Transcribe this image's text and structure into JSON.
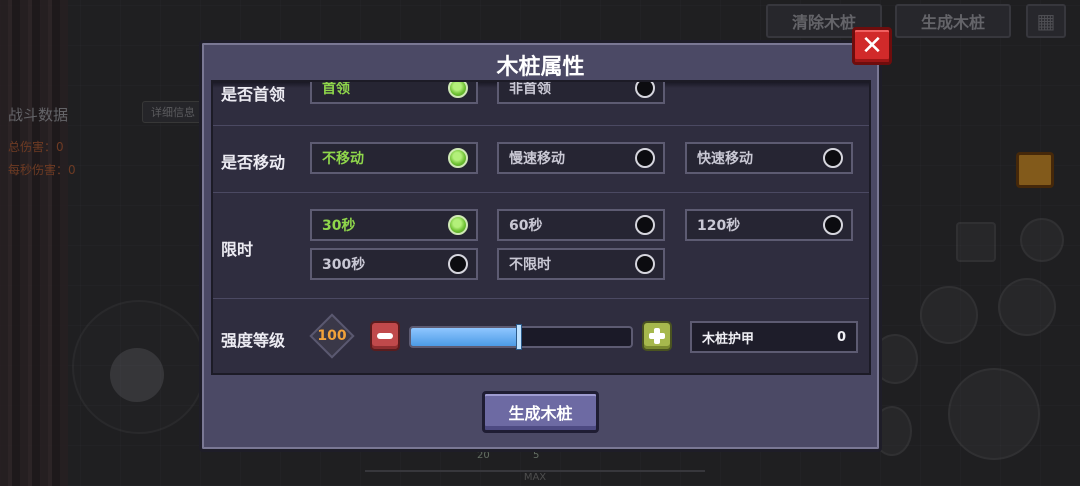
{
  "background": {
    "top_buttons": {
      "clear": "清除木桩",
      "generate": "生成木桩"
    },
    "stats": {
      "title": "战斗数据",
      "detail_button": "详细信息",
      "total_damage": "总伤害：0",
      "dps": "每秒伤害：0"
    },
    "bottom_bar": {
      "label": "MAX",
      "counts": [
        "20",
        "5"
      ]
    }
  },
  "modal": {
    "title": "木桩属性",
    "close_icon": "close-icon",
    "rows": {
      "boss": {
        "label": "是否首领",
        "options": [
          {
            "label": "首领",
            "selected": true
          },
          {
            "label": "非首领",
            "selected": false
          }
        ]
      },
      "move": {
        "label": "是否移动",
        "options": [
          {
            "label": "不移动",
            "selected": true
          },
          {
            "label": "慢速移动",
            "selected": false
          },
          {
            "label": "快速移动",
            "selected": false
          }
        ]
      },
      "time": {
        "label": "限时",
        "options": [
          {
            "label": "30秒",
            "selected": true
          },
          {
            "label": "60秒",
            "selected": false
          },
          {
            "label": "120秒",
            "selected": false
          },
          {
            "label": "300秒",
            "selected": false
          },
          {
            "label": "不限时",
            "selected": false
          }
        ]
      },
      "strength": {
        "label": "强度等级",
        "level": "100",
        "slider_fraction": 0.49,
        "armor_label": "木桩护甲",
        "armor_value": "0"
      }
    },
    "generate_button": "生成木桩"
  },
  "colors": {
    "selected_text": "#8fd64b",
    "level_text": "#f2a23a",
    "close_button": "#d12a2a",
    "slider_fill": "#4c9be6"
  }
}
